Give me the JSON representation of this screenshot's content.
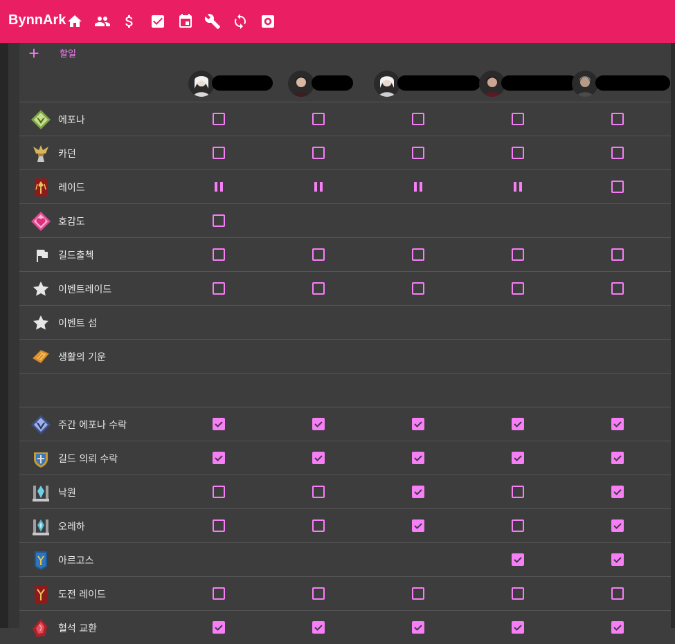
{
  "app": {
    "title": "BynnArk"
  },
  "nav": [
    "home-icon",
    "people-icon",
    "dollar-icon",
    "checkbox-icon",
    "calendar-icon",
    "wrench-icon",
    "sync-icon",
    "settings-icon"
  ],
  "add_todo": {
    "label": "할일"
  },
  "colors": {
    "appbar": "#ea1f63",
    "accent": "#f87ef8",
    "background": "#3d3d3d"
  },
  "characters": [
    {
      "avatar": "avatar-icon"
    },
    {
      "avatar": "avatar-icon"
    },
    {
      "avatar": "avatar-icon"
    },
    {
      "avatar": "avatar-icon"
    },
    {
      "avatar": "avatar-icon"
    }
  ],
  "rows": [
    {
      "label": "에포나",
      "icon": "epona-icon",
      "states": [
        "empty",
        "empty",
        "empty",
        "empty",
        "empty"
      ]
    },
    {
      "label": "카던",
      "icon": "chaos-dungeon-icon",
      "states": [
        "empty",
        "empty",
        "empty",
        "empty",
        "empty"
      ]
    },
    {
      "label": "레이드",
      "icon": "raid-icon",
      "states": [
        "paused",
        "paused",
        "paused",
        "paused",
        "empty"
      ]
    },
    {
      "label": "호감도",
      "icon": "rapport-icon",
      "states": [
        "empty",
        "none",
        "none",
        "none",
        "none"
      ]
    },
    {
      "label": "길드출첵",
      "icon": "flag-icon",
      "states": [
        "empty",
        "empty",
        "empty",
        "empty",
        "empty"
      ]
    },
    {
      "label": "이벤트레이드",
      "icon": "star-icon",
      "states": [
        "empty",
        "empty",
        "empty",
        "empty",
        "empty"
      ]
    },
    {
      "label": "이벤트 섬",
      "icon": "star-icon",
      "states": [
        "none",
        "none",
        "none",
        "none",
        "none"
      ]
    },
    {
      "label": "생활의 기운",
      "icon": "life-energy-icon",
      "states": [
        "none",
        "none",
        "none",
        "none",
        "none"
      ]
    },
    {
      "label": "",
      "icon": "",
      "states": [
        "none",
        "none",
        "none",
        "none",
        "none"
      ]
    },
    {
      "label": "주간 에포나 수락",
      "icon": "weekly-epona-icon",
      "states": [
        "checked",
        "checked",
        "checked",
        "checked",
        "checked"
      ]
    },
    {
      "label": "길드 의뢰 수락",
      "icon": "guild-request-icon",
      "states": [
        "checked",
        "checked",
        "checked",
        "checked",
        "checked"
      ]
    },
    {
      "label": "낙원",
      "icon": "paradise-icon",
      "states": [
        "empty",
        "empty",
        "checked",
        "empty",
        "checked"
      ]
    },
    {
      "label": "오레하",
      "icon": "oreha-icon",
      "states": [
        "empty",
        "empty",
        "checked",
        "empty",
        "checked"
      ]
    },
    {
      "label": "아르고스",
      "icon": "argos-icon",
      "states": [
        "none",
        "none",
        "none",
        "checked",
        "checked"
      ]
    },
    {
      "label": "도전 레이드",
      "icon": "challenge-raid-icon",
      "states": [
        "empty",
        "empty",
        "empty",
        "empty",
        "empty"
      ]
    },
    {
      "label": "혈석 교환",
      "icon": "bloodstone-icon",
      "states": [
        "checked",
        "checked",
        "checked",
        "checked",
        "checked"
      ]
    }
  ]
}
